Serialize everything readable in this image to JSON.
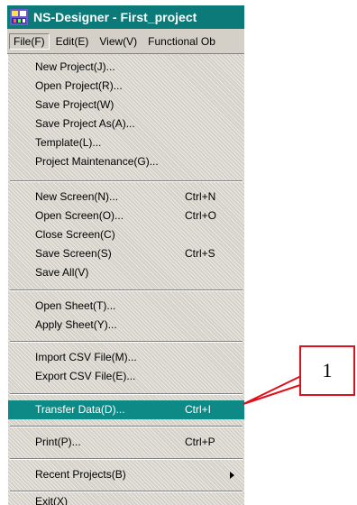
{
  "window": {
    "title": "NS-Designer - First_project",
    "icon": "ns-designer-app-icon"
  },
  "menubar": {
    "items": [
      {
        "label": "File(F)",
        "active": true
      },
      {
        "label": "Edit(E)",
        "active": false
      },
      {
        "label": "View(V)",
        "active": false
      },
      {
        "label": "Functional Ob",
        "active": false
      }
    ]
  },
  "file_menu": {
    "items": [
      {
        "label": "New Project(J)...",
        "shortcut": ""
      },
      {
        "label": "Open Project(R)...",
        "shortcut": ""
      },
      {
        "label": "Save Project(W)",
        "shortcut": ""
      },
      {
        "label": "Save Project As(A)...",
        "shortcut": ""
      },
      {
        "label": "Template(L)...",
        "shortcut": ""
      },
      {
        "label": "Project Maintenance(G)...",
        "shortcut": ""
      },
      {
        "label": "New Screen(N)...",
        "shortcut": "Ctrl+N"
      },
      {
        "label": "Open Screen(O)...",
        "shortcut": "Ctrl+O"
      },
      {
        "label": "Close Screen(C)",
        "shortcut": ""
      },
      {
        "label": "Save Screen(S)",
        "shortcut": "Ctrl+S"
      },
      {
        "label": "Save All(V)",
        "shortcut": ""
      },
      {
        "label": "Open Sheet(T)...",
        "shortcut": ""
      },
      {
        "label": "Apply Sheet(Y)...",
        "shortcut": ""
      },
      {
        "label": "Import CSV File(M)...",
        "shortcut": ""
      },
      {
        "label": "Export CSV File(E)...",
        "shortcut": ""
      },
      {
        "label": "Transfer Data(D)...",
        "shortcut": "Ctrl+I",
        "highlighted": true
      },
      {
        "label": "Print(P)...",
        "shortcut": "Ctrl+P"
      },
      {
        "label": "Recent Projects(B)",
        "shortcut": "",
        "submenu": true
      },
      {
        "label": "Exit(X)",
        "shortcut": ""
      }
    ]
  },
  "callout": {
    "label": "1",
    "color": "#e0101a"
  },
  "colors": {
    "titlebar": "#0c7a78",
    "highlight": "#0e8a86",
    "menu_bg": "#d4d0c8"
  }
}
